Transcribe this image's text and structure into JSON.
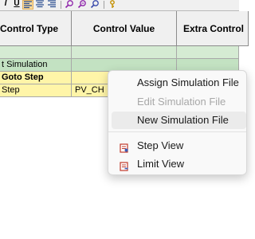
{
  "toolbar": {
    "buttons": [
      {
        "icon": "italic-icon",
        "glyph": "I"
      },
      {
        "icon": "underline-icon",
        "glyph": "U"
      },
      {
        "icon": "align-left-icon",
        "glyph": "≡"
      },
      {
        "icon": "align-center-icon",
        "glyph": "≡"
      },
      {
        "icon": "align-right-icon",
        "glyph": "≡"
      },
      {
        "icon": "zoom-in-icon",
        "glyph": "🔍"
      },
      {
        "icon": "zoom-reset-icon",
        "glyph": "⌕"
      },
      {
        "icon": "search-icon",
        "glyph": "⌕"
      },
      {
        "icon": "key-icon",
        "glyph": "♪"
      }
    ]
  },
  "grid": {
    "headers": {
      "control_type": "Control Type",
      "control_value": "Control Value",
      "extra_control": "Extra Control"
    },
    "rows": [
      {
        "col1": "",
        "col2": "",
        "col3": ""
      },
      {
        "col1": "t Simulation",
        "col2": "",
        "col3": ""
      },
      {
        "col1": "Goto Step",
        "col2": "",
        "col3": ""
      },
      {
        "col1": "Step",
        "col2": "PV_CH",
        "col3": ""
      }
    ]
  },
  "context_menu": {
    "items": [
      {
        "label": "Assign Simulation File",
        "enabled": true
      },
      {
        "label": "Edit Simulation File",
        "enabled": false
      },
      {
        "label": "New Simulation File",
        "enabled": true
      },
      {
        "label": "Step View",
        "enabled": true,
        "icon": "step-view-icon"
      },
      {
        "label": "Limit View",
        "enabled": true,
        "icon": "limit-view-icon"
      }
    ]
  },
  "colors": {
    "row_green": "#c3e2c2",
    "row_yellow": "#fff5a8",
    "menu_hover": "#ebebeb",
    "icon_red": "#c0392b"
  }
}
